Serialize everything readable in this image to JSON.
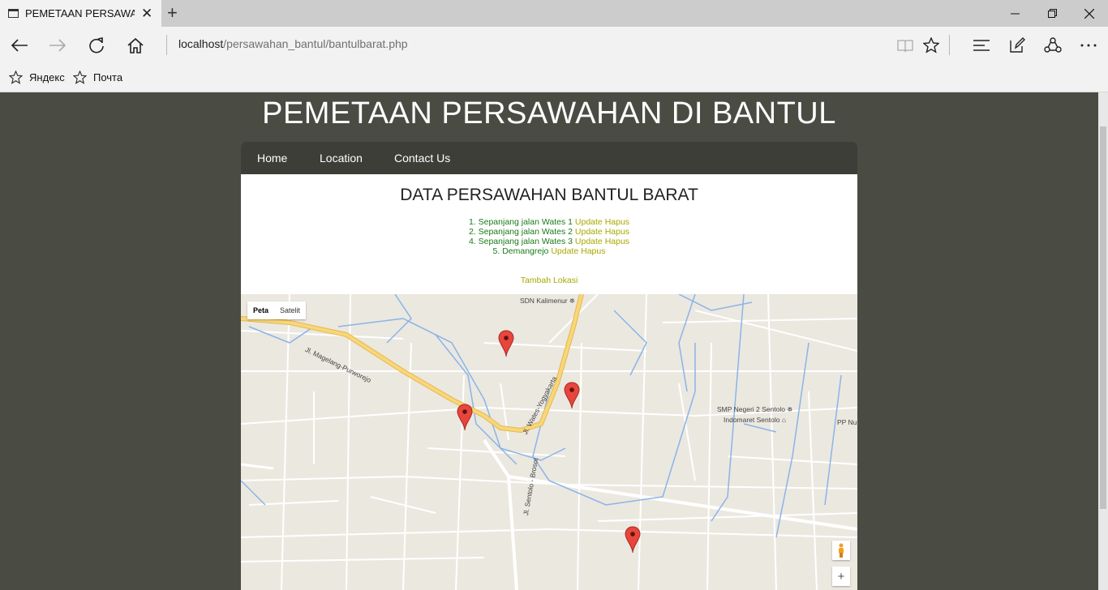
{
  "browser": {
    "tab_title": "PEMETAAN PERSAWAHAN DI BANTUL",
    "address_host": "localhost",
    "address_path": "/persawahan_bantul/bantulbarat.php",
    "favorites": [
      {
        "label": "Яндекс"
      },
      {
        "label": "Почта"
      }
    ]
  },
  "site": {
    "title": "PEMETAAN PERSAWAHAN DI BANTUL",
    "nav": [
      {
        "label": "Home"
      },
      {
        "label": "Location"
      },
      {
        "label": "Contact Us"
      }
    ]
  },
  "content": {
    "heading": "DATA PERSAWAHAN BANTUL BARAT",
    "items": [
      {
        "name": "1. Sepanjang jalan Wates 1",
        "update": "Update",
        "delete": "Hapus"
      },
      {
        "name": "2. Sepanjang jalan Wates 2",
        "update": "Update",
        "delete": "Hapus"
      },
      {
        "name": "4. Sepanjang jalan Wates 3",
        "update": "Update",
        "delete": "Hapus"
      },
      {
        "name": "5. Demangrejo",
        "update": "Update",
        "delete": "Hapus"
      }
    ],
    "add_link": "Tambah Lokasi"
  },
  "map": {
    "type_buttons": [
      "Peta",
      "Satelit"
    ],
    "labels": {
      "school1": "SDN Kalimenur",
      "school2": "SMP Negeri 2 Sentolo",
      "shop": "Indomaret Sentolo",
      "pp": "PP Nu",
      "road1": "Jl. Magelang-Purworejo",
      "road2": "Jl. Wates-Yogyakarta",
      "road3": "Jl. Sentolo - Brosot"
    },
    "zoom_in": "+"
  },
  "colors": {
    "background": "#4a4c44",
    "nav": "#3d3e38",
    "link_green": "#1a7a1a",
    "link_olive": "#a8a800",
    "marker": "#e8453c"
  }
}
